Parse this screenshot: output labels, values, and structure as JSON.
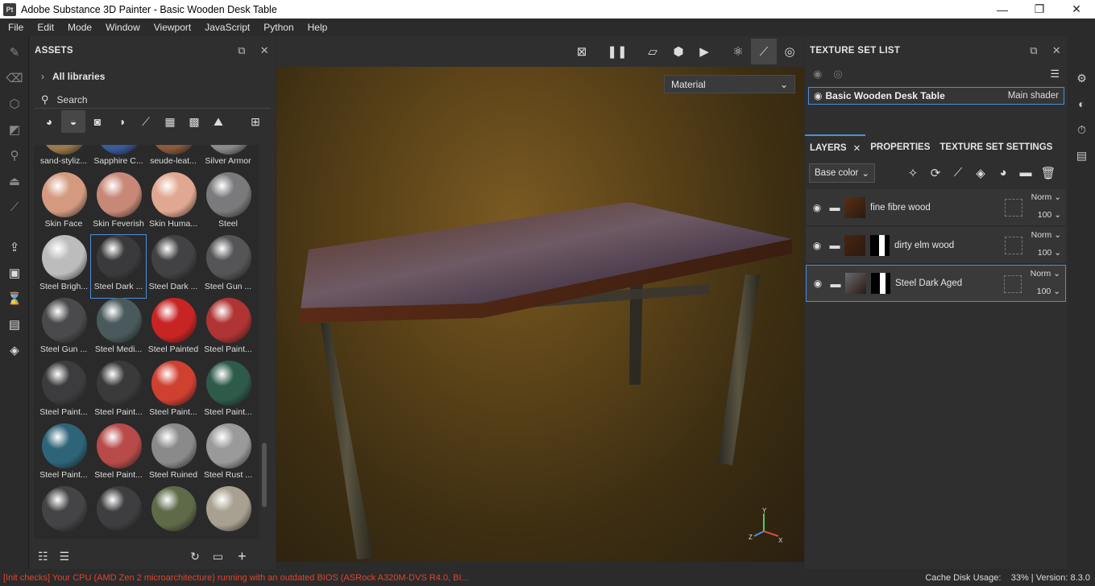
{
  "window": {
    "title": "Adobe Substance 3D Painter - Basic Wooden Desk Table",
    "app_icon": "Pt",
    "minimize": "—",
    "maximize": "❐",
    "close": "✕"
  },
  "menu": [
    "File",
    "Edit",
    "Mode",
    "Window",
    "Viewport",
    "JavaScript",
    "Python",
    "Help"
  ],
  "assets": {
    "title": "ASSETS",
    "libraries": "All libraries",
    "search_placeholder": "Search",
    "items": [
      {
        "label": "sand-styliz...",
        "color": "#9a7a4a"
      },
      {
        "label": "Sapphire C...",
        "color": "#3a5a9a"
      },
      {
        "label": "seude-leat...",
        "color": "#8a5a3a"
      },
      {
        "label": "Silver Armor",
        "color": "#8a8a8a"
      },
      {
        "label": "Skin Face",
        "color": "#d49a80"
      },
      {
        "label": "Skin Feverish",
        "color": "#c88878"
      },
      {
        "label": "Skin Huma...",
        "color": "#e0a890"
      },
      {
        "label": "Steel",
        "color": "#7a7a7c"
      },
      {
        "label": "Steel Brigh...",
        "color": "#bcbcbc"
      },
      {
        "label": "Steel Dark ...",
        "color": "#3a3a3c"
      },
      {
        "label": "Steel Dark ...",
        "color": "#424244"
      },
      {
        "label": "Steel Gun ...",
        "color": "#555557"
      },
      {
        "label": "Steel Gun ...",
        "color": "#4a4a4c"
      },
      {
        "label": "Steel Medi...",
        "color": "#4a5a5c"
      },
      {
        "label": "Steel Painted",
        "color": "#c82424"
      },
      {
        "label": "Steel Paint...",
        "color": "#b03434"
      },
      {
        "label": "Steel Paint...",
        "color": "#3c3c3e"
      },
      {
        "label": "Steel Paint...",
        "color": "#3a3a3a"
      },
      {
        "label": "Steel Paint...",
        "color": "#d04030"
      },
      {
        "label": "Steel Paint...",
        "color": "#2e5a4a"
      },
      {
        "label": "Steel Paint...",
        "color": "#2e6478"
      },
      {
        "label": "Steel Paint...",
        "color": "#b84a4a"
      },
      {
        "label": "Steel Ruined",
        "color": "#8a8a8a"
      },
      {
        "label": "Steel Rust ...",
        "color": "#9a9a9a"
      },
      {
        "label": "",
        "color": "#444446"
      },
      {
        "label": "",
        "color": "#3e3e40"
      },
      {
        "label": "",
        "color": "#5e6a48"
      },
      {
        "label": "",
        "color": "#a8a090"
      }
    ],
    "selected_index": 9
  },
  "viewport": {
    "material_select": "Material",
    "axis_y": "Y",
    "axis_z": "Z",
    "axis_x": "X"
  },
  "texture_set_list": {
    "title": "TEXTURE SET LIST",
    "set_name": "Basic Wooden Desk Table",
    "shader": "Main shader"
  },
  "layers_panel": {
    "tabs": [
      "LAYERS",
      "PROPERTIES",
      "TEXTURE SET SETTINGS"
    ],
    "channel": "Base color",
    "layers": [
      {
        "name": "fine fibre wood",
        "blend": "Norm",
        "opacity": "100",
        "thumb": "#5a2e14",
        "mask": ""
      },
      {
        "name": "dirty elm wood",
        "blend": "Norm",
        "opacity": "100",
        "thumb": "#4a2412",
        "mask": "bw"
      },
      {
        "name": "Steel Dark Aged",
        "blend": "Norm",
        "opacity": "100",
        "thumb": "#6a6a70",
        "mask": "bw"
      }
    ],
    "selected_layer": 2
  },
  "status": {
    "message": "[Init checks] Your CPU (AMD Zen 2 microarchitecture) running with an outdated BIOS (ASRock A320M-DVS R4.0, BI...",
    "cache": "Cache Disk Usage:",
    "cache_value": "33%",
    "version": "Version: 8.3.0",
    "error_color": "#e0442d",
    "accent_color": "#4a8fd9"
  }
}
